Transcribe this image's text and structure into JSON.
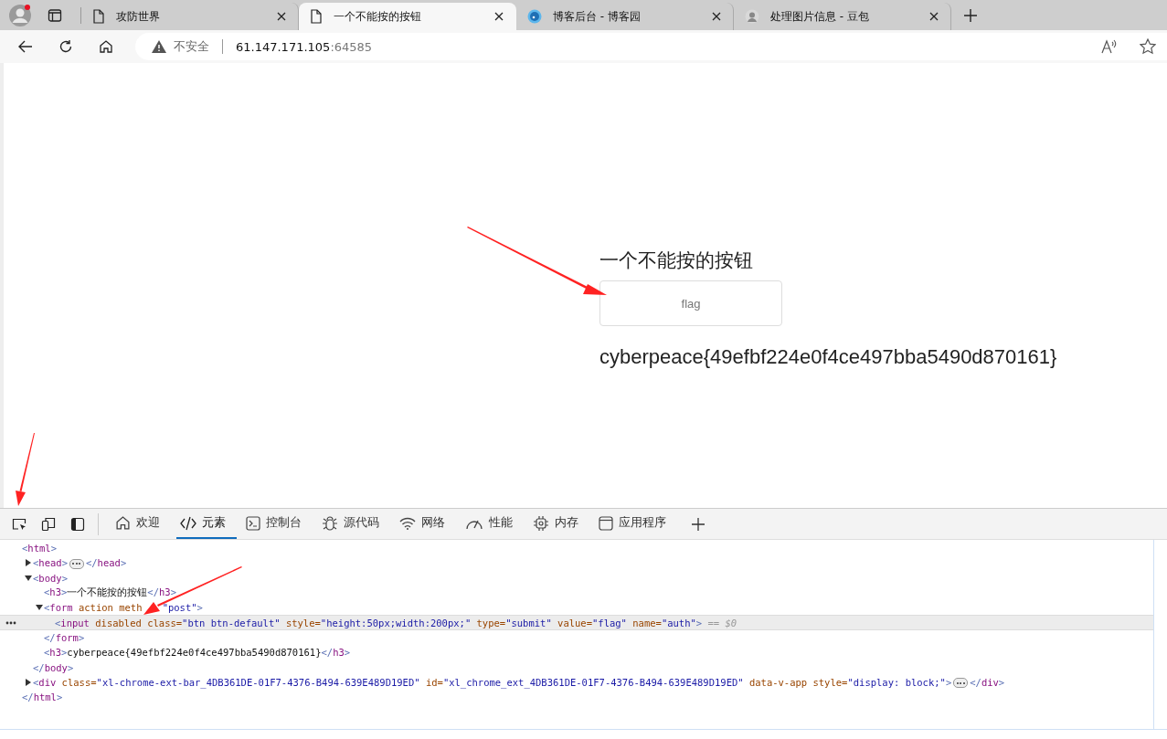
{
  "browser": {
    "tabs": [
      {
        "title": "攻防世界",
        "selected": false
      },
      {
        "title": "一个不能按的按钮",
        "selected": true
      },
      {
        "title": "博客后台 - 博客园",
        "selected": false
      },
      {
        "title": "处理图片信息 - 豆包",
        "selected": false
      }
    ],
    "address": {
      "security": "不安全",
      "host": "61.147.171.105",
      "port": ":64585"
    }
  },
  "page": {
    "heading": "一个不能按的按钮",
    "button": {
      "label": "flag",
      "disabled": true
    },
    "flag": "cyberpeace{49efbf224e0f4ce497bba5490d870161}"
  },
  "devtools": {
    "tabs": [
      {
        "label": "欢迎",
        "selected": false
      },
      {
        "label": "元素",
        "selected": true
      },
      {
        "label": "控制台",
        "selected": false
      },
      {
        "label": "源代码",
        "selected": false
      },
      {
        "label": "网络",
        "selected": false
      },
      {
        "label": "性能",
        "selected": false
      },
      {
        "label": "内存",
        "selected": false
      },
      {
        "label": "应用程序",
        "selected": false
      }
    ],
    "dom": [
      {
        "selected": false,
        "line": [
          {
            "kind": "p",
            "t": "<"
          },
          {
            "kind": "tag",
            "t": "html"
          },
          {
            "kind": "p",
            "t": ">"
          }
        ],
        "closing": [
          {
            "kind": "p",
            "t": "</"
          },
          {
            "kind": "tag",
            "t": "html"
          },
          {
            "kind": "p",
            "t": ">"
          }
        ],
        "children": [
          {
            "selected": false,
            "expanded": false,
            "line": [
              {
                "kind": "p",
                "t": "<"
              },
              {
                "kind": "tag",
                "t": "head"
              },
              {
                "kind": "p",
                "t": ">"
              },
              {
                "kind": "more"
              },
              {
                "kind": "p",
                "t": "</"
              },
              {
                "kind": "tag",
                "t": "head"
              },
              {
                "kind": "p",
                "t": ">"
              }
            ]
          },
          {
            "selected": false,
            "expanded": true,
            "line": [
              {
                "kind": "p",
                "t": "<"
              },
              {
                "kind": "tag",
                "t": "body"
              },
              {
                "kind": "p",
                "t": ">"
              }
            ],
            "closing": [
              {
                "kind": "p",
                "t": "</"
              },
              {
                "kind": "tag",
                "t": "body"
              },
              {
                "kind": "p",
                "t": ">"
              }
            ],
            "children": [
              {
                "selected": false,
                "line": [
                  {
                    "kind": "p",
                    "t": "<"
                  },
                  {
                    "kind": "tag",
                    "t": "h3"
                  },
                  {
                    "kind": "p",
                    "t": ">"
                  },
                  {
                    "kind": "text",
                    "t": "一个不能按的按钮"
                  },
                  {
                    "kind": "p",
                    "t": "</"
                  },
                  {
                    "kind": "tag",
                    "t": "h3"
                  },
                  {
                    "kind": "p",
                    "t": ">"
                  }
                ]
              },
              {
                "selected": false,
                "expanded": true,
                "line": [
                  {
                    "kind": "p",
                    "t": "<"
                  },
                  {
                    "kind": "tag",
                    "t": "form"
                  },
                  {
                    "kind": "attr",
                    "t": " action"
                  },
                  {
                    "kind": "attr",
                    "t": " meth"
                  },
                  {
                    "kind": "covered"
                  },
                  {
                    "kind": "val",
                    "t": "\"post\""
                  },
                  {
                    "kind": "p",
                    "t": ">"
                  }
                ],
                "closing": [
                  {
                    "kind": "p",
                    "t": "</"
                  },
                  {
                    "kind": "tag",
                    "t": "form"
                  },
                  {
                    "kind": "p",
                    "t": ">"
                  }
                ],
                "children": [
                  {
                    "selected": true,
                    "line": [
                      {
                        "kind": "p",
                        "t": "<"
                      },
                      {
                        "kind": "tag",
                        "t": "input"
                      },
                      {
                        "kind": "attr",
                        "t": " disabled"
                      },
                      {
                        "kind": "attr",
                        "t": " class="
                      },
                      {
                        "kind": "val",
                        "t": "\"btn btn-default\""
                      },
                      {
                        "kind": "attr",
                        "t": " style="
                      },
                      {
                        "kind": "val",
                        "t": "\"height:50px;width:200px;\""
                      },
                      {
                        "kind": "attr",
                        "t": " type="
                      },
                      {
                        "kind": "val",
                        "t": "\"submit\""
                      },
                      {
                        "kind": "attr",
                        "t": " value="
                      },
                      {
                        "kind": "val",
                        "t": "\"flag\""
                      },
                      {
                        "kind": "attr",
                        "t": " name="
                      },
                      {
                        "kind": "val",
                        "t": "\"auth\""
                      },
                      {
                        "kind": "p",
                        "t": ">"
                      },
                      {
                        "kind": "hint",
                        "t": " == $0"
                      }
                    ]
                  }
                ]
              },
              {
                "selected": false,
                "line": [
                  {
                    "kind": "p",
                    "t": "<"
                  },
                  {
                    "kind": "tag",
                    "t": "h3"
                  },
                  {
                    "kind": "p",
                    "t": ">"
                  },
                  {
                    "kind": "text",
                    "t": "cyberpeace{49efbf224e0f4ce497bba5490d870161}"
                  },
                  {
                    "kind": "p",
                    "t": "</"
                  },
                  {
                    "kind": "tag",
                    "t": "h3"
                  },
                  {
                    "kind": "p",
                    "t": ">"
                  }
                ]
              }
            ]
          },
          {
            "selected": false,
            "expanded": false,
            "line": [
              {
                "kind": "p",
                "t": "<"
              },
              {
                "kind": "tag",
                "t": "div"
              },
              {
                "kind": "attr",
                "t": " class="
              },
              {
                "kind": "val",
                "t": "\"xl-chrome-ext-bar_4DB361DE-01F7-4376-B494-639E489D19ED\""
              },
              {
                "kind": "attr",
                "t": " id="
              },
              {
                "kind": "val",
                "t": "\"xl_chrome_ext_4DB361DE-01F7-4376-B494-639E489D19ED\""
              },
              {
                "kind": "attr",
                "t": " data-v-app"
              },
              {
                "kind": "attr",
                "t": " style="
              },
              {
                "kind": "val",
                "t": "\"display: block;\""
              },
              {
                "kind": "p",
                "t": ">"
              },
              {
                "kind": "more"
              },
              {
                "kind": "p",
                "t": "</"
              },
              {
                "kind": "tag",
                "t": "div"
              },
              {
                "kind": "p",
                "t": ">"
              }
            ]
          }
        ]
      }
    ]
  }
}
